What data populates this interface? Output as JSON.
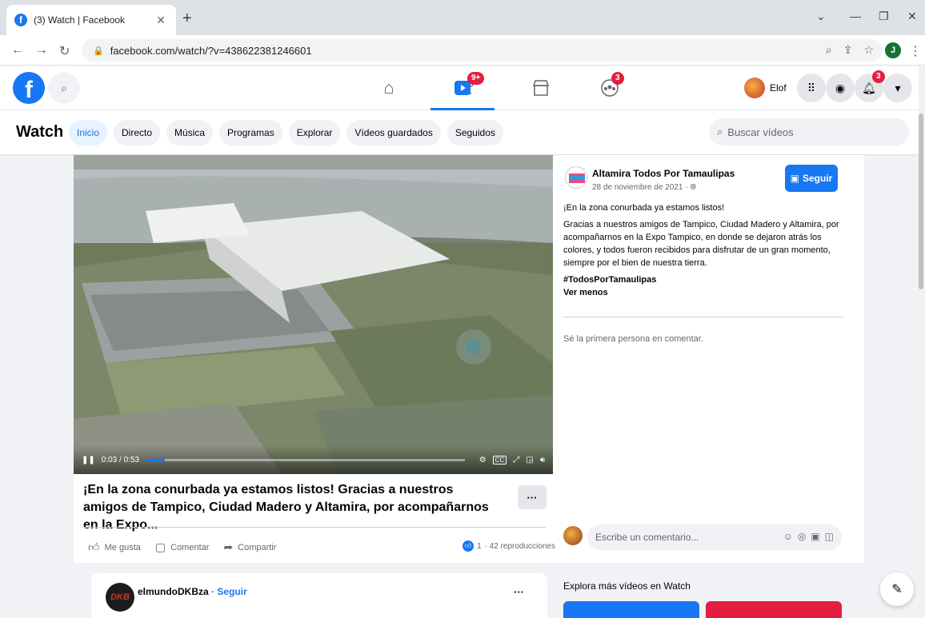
{
  "browser": {
    "tab_title": "(3) Watch | Facebook",
    "url": "facebook.com/watch/?v=438622381246601",
    "profile_initial": "J"
  },
  "header": {
    "profile_name": "Elof",
    "watch_badge": "9+",
    "groups_badge": "3",
    "notif_badge": "3"
  },
  "watch": {
    "title": "Watch",
    "tabs": [
      "Inicio",
      "Directo",
      "Música",
      "Programas",
      "Explorar",
      "Vídeos guardados",
      "Seguidos"
    ],
    "search_placeholder": "Buscar vídeos"
  },
  "video": {
    "time": "0:03 / 0:53",
    "progress": 0.06,
    "title": "¡En la zona conurbada ya estamos listos! Gracias a nuestros amigos de Tampico, Ciudad Madero y Altamira, por acompañarnos en la Expo...",
    "actions": [
      "Me gusta",
      "Comentar",
      "Compartir"
    ],
    "likes": "1",
    "views": "· 42 reproducciones"
  },
  "post": {
    "page_name": "Altamira Todos Por Tamaulipas",
    "date": "28 de noviembre de 2021 · ",
    "follow_label": "Seguir",
    "line1": "¡En la zona conurbada ya estamos listos!",
    "body": "Gracias a nuestros amigos de Tampico, Ciudad Madero y Altamira, por acompañarnos en la Expo Tampico, en donde se dejaron atrás los colores, y todos fueron recibidos para disfrutar de un gran momento, siempre por el bien de nuestra tierra.",
    "hashtag": "#TodosPorTamaulipas",
    "see_less": "Ver menos",
    "first_comment": "Sé la primera persona en comentar.",
    "comment_placeholder": "Escribe un comentario..."
  },
  "next_post": {
    "name": "elmundoDKBza",
    "follow": " · Seguir",
    "avatar_text": "DKB"
  },
  "explore": {
    "title": "Explora más vídeos en Watch"
  }
}
